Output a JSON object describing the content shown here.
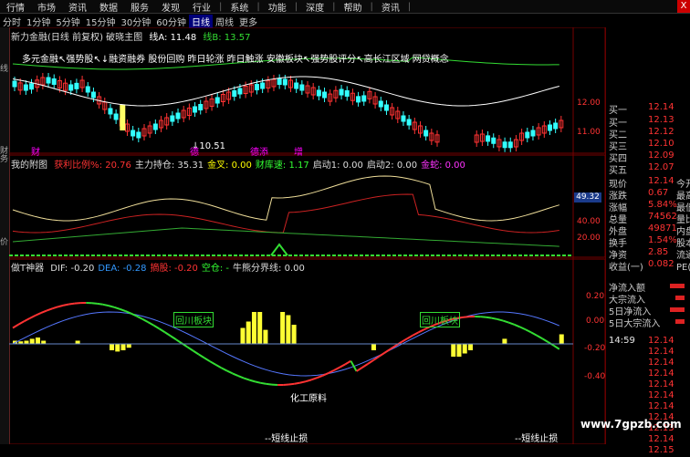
{
  "menu": {
    "items": [
      "行情",
      "市场",
      "资讯",
      "数据",
      "服务",
      "发现",
      "行业",
      "系统",
      "功能",
      "深度",
      "帮助",
      "资讯"
    ],
    "close_label": "X"
  },
  "tabs": {
    "items": [
      "分时",
      "1分钟",
      "5分钟",
      "15分钟",
      "30分钟",
      "60分钟",
      "日线",
      "周线",
      "更多"
    ],
    "active_index": 6
  },
  "left_labels": [
    "线",
    "财务",
    "价"
  ],
  "main_panel": {
    "title": "新力金融(日线 前复权) 破晓主图",
    "line_a_label": "线A: 11.48",
    "line_b_label": "线B: 13.57",
    "tags": "多元金融↖强势股↖↓融资融券 股份回购 昨日轮涨 昨日触涨 安徽板块↖强势股评分↖高长江区域 网贷概念",
    "low_marker": "↓10.51",
    "event_labels": [
      "财",
      "德",
      "增"
    ],
    "event_mid": "德添",
    "price_ticks": [
      "12.00",
      "11.00"
    ]
  },
  "sub1": {
    "title": "我的附图",
    "indicators": [
      {
        "text": "获利比例%: 20.76",
        "color": "#ff3333"
      },
      {
        "text": "主力持仓: 35.31",
        "color": "#dddddd"
      },
      {
        "text": "金叉: 0.00",
        "color": "#ffff00"
      },
      {
        "text": "财库速: 1.17",
        "color": "#33ff33"
      },
      {
        "text": "启动1: 0.00",
        "color": "#dddddd"
      },
      {
        "text": "启动2: 0.00",
        "color": "#dddddd"
      },
      {
        "text": "金蛇: 0.00",
        "color": "#ff33ff"
      }
    ],
    "value_badge": "49.32",
    "ticks": [
      "40.00",
      "20.00"
    ]
  },
  "sub2": {
    "title": "做T神器",
    "indicators": [
      {
        "text": "DIF: -0.20",
        "color": "#dddddd"
      },
      {
        "text": "DEA: -0.28",
        "color": "#3399ff"
      },
      {
        "text": "摘股: -0.20",
        "color": "#ff3333"
      },
      {
        "text": "空仓: -",
        "color": "#33ff33"
      },
      {
        "text": "牛熊分界线: 0.00",
        "color": "#dddddd"
      }
    ],
    "boxes": [
      "回川板块",
      "回川板块"
    ],
    "sector_label": "化工原料",
    "stop_labels": [
      "--短线止损",
      "--短线止损"
    ],
    "ticks": [
      "0.20",
      "0.00",
      "-0.20",
      "-0.40"
    ]
  },
  "right_panel": {
    "sell_rows": [
      {
        "k": "买一",
        "v": "12.13"
      },
      {
        "k": "买二",
        "v": "12.12"
      },
      {
        "k": "买三",
        "v": "12.10"
      },
      {
        "k": "买四",
        "v": "12.09"
      },
      {
        "k": "买五",
        "v": "12.07"
      }
    ],
    "top_row": {
      "k": "买一",
      "v": "12.14"
    },
    "quote_rows": [
      {
        "k": "现价",
        "v": "12.14",
        "v2": "今开"
      },
      {
        "k": "涨跌",
        "v": "0.67",
        "v2": "最高"
      },
      {
        "k": "涨幅",
        "v": "5.84%",
        "v2": "最低"
      },
      {
        "k": "总量",
        "v": "74562",
        "v2": "量比"
      },
      {
        "k": "外盘",
        "v": "49871",
        "v2": "内盘"
      },
      {
        "k": "换手",
        "v": "1.54%",
        "v2": "股本"
      },
      {
        "k": "净资",
        "v": "2.85",
        "v2": "流通"
      },
      {
        "k": "收益(一)",
        "v": "0.082",
        "v2": "PE(动"
      }
    ],
    "flow_rows": [
      "净流入额",
      "大宗流入",
      "5日净流入",
      "5日大宗流入"
    ],
    "tick_time": "14:59",
    "tick_prices": [
      "12.14",
      "12.14",
      "12.14",
      "12.14",
      "12.14",
      "12.14",
      "12.14",
      "12.14",
      "12.13",
      "12.14",
      "12.15"
    ]
  },
  "watermark": "www.7gpzb.com",
  "colors": {
    "up": "#ff3333",
    "down": "#33ffff",
    "yellow": "#ffff33",
    "magenta": "#ff33ff",
    "green": "#33dd33"
  },
  "chart_data": {
    "type": "candlestick",
    "macd_hist": [
      0.05,
      0.04,
      0.05,
      0.08,
      0.1,
      0.05,
      0,
      0,
      0,
      0,
      0,
      0.05,
      0,
      0,
      0,
      0,
      0,
      -0.1,
      -0.12,
      -0.1,
      -0.06,
      0,
      0,
      0,
      0,
      0,
      0,
      0,
      0,
      0,
      0,
      0,
      0,
      0,
      0,
      0,
      0,
      0,
      0,
      0,
      0.25,
      0.35,
      0.5,
      0.5,
      0.22,
      0,
      0,
      0.5,
      0.45,
      0.3,
      0,
      0,
      0,
      0,
      0,
      0,
      0,
      0,
      0,
      0,
      0,
      0,
      0,
      -0.1,
      0,
      0,
      0,
      0,
      0,
      0,
      0,
      0,
      0,
      0,
      0,
      0,
      0,
      -0.2,
      -0.2,
      -0.15,
      -0.1,
      0,
      0,
      0,
      0,
      0,
      0.08,
      0,
      0,
      0,
      0,
      0,
      0,
      0,
      0,
      0,
      0.15
    ]
  }
}
